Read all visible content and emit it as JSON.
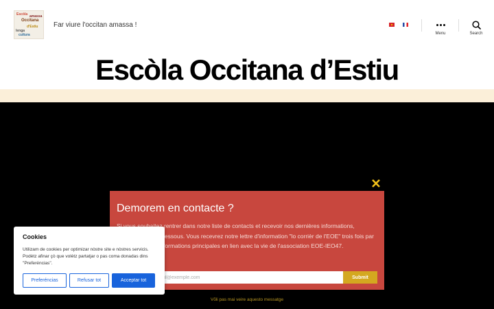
{
  "header": {
    "logo_words": [
      "Escòla",
      "Occitana",
      "d'Estiu",
      "lenga",
      "cultura",
      "amassa"
    ],
    "tagline": "Far viure l'occitan amassa !",
    "languages": [
      {
        "code": "oc",
        "flag": "flag-occitan-icon"
      },
      {
        "code": "fr",
        "flag": "flag-france-icon"
      }
    ],
    "menu_label": "Menu",
    "search_label": "Search"
  },
  "site_title": "Escòla Occitana d’Estiu",
  "popup": {
    "title": "Demorem en contacte ?",
    "body": "Si vous souhaitez rentrer dans notre liste de contacts et recevoir nos dernières informations, inscrivez-vous ci-dessous. Vous recevrez notre lettre d'information \"lo corrièr de l'EOE\" trois fois par an ainsi que les informations principales en lien avec la vie de l'association EOE-IEO47.",
    "email_placeholder": "email@exemple.com",
    "submit_label": "Submit",
    "dismiss_label": "Võli pas mai veire aquesto messatge",
    "close_icon": "close-icon",
    "colors": {
      "background": "#c8473e",
      "submit": "#d4a820",
      "close": "#f2c21a"
    }
  },
  "cookie": {
    "title": "Cookies",
    "text": "Utilizam de cookies per optimizar nòstre site e nòstres servicis. Podètz afinar çò que volètz partatjar o pas coma donadas dins \"Preferéncias\".",
    "buttons": {
      "preferences": "Preferéncias",
      "refuse": "Refusar tot",
      "accept": "Acceptar tot"
    },
    "accent": "#1863dc"
  }
}
